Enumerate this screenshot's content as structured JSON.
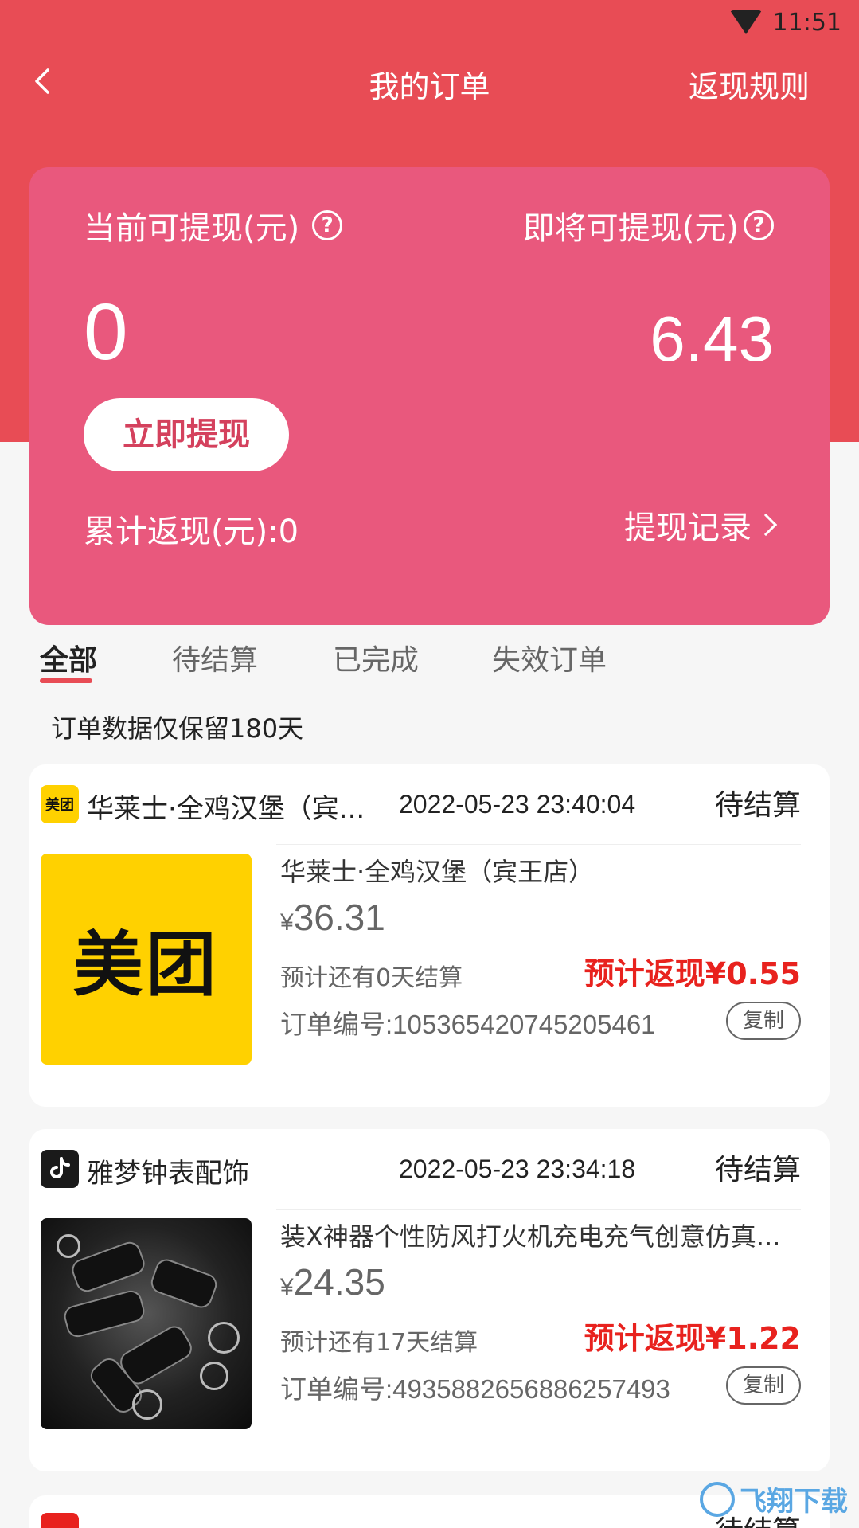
{
  "status_bar": {
    "time": "11:51",
    "wifi_icon": "wifi-icon"
  },
  "nav": {
    "title": "我的订单",
    "rule_link": "返现规则",
    "back_icon": "chevron-left-icon"
  },
  "balance_card": {
    "available_label": "当前可提现(元)",
    "available_amount": "0",
    "upcoming_label": "即将可提现(元)",
    "upcoming_amount": "6.43",
    "withdraw_button": "立即提现",
    "total_cashback": "累计返现(元):0",
    "record_link": "提现记录"
  },
  "tabs": [
    {
      "label": "全部",
      "active": true
    },
    {
      "label": "待结算",
      "active": false
    },
    {
      "label": "已完成",
      "active": false
    },
    {
      "label": "失效订单",
      "active": false
    }
  ],
  "notice": "订单数据仅保留180天",
  "orders": [
    {
      "shop_icon": "meituan-icon",
      "shop_icon_text": "美团",
      "shop_name": "华莱士·全鸡汉堡（宾...",
      "time": "2022-05-23 23:40:04",
      "status": "待结算",
      "thumb_text": "美团",
      "title": "华莱士·全鸡汉堡（宾王店）",
      "currency": "¥",
      "price": "36.31",
      "settle_text": "预计还有0天结算",
      "cashback": "预计返现¥0.55",
      "order_no": "订单编号:1053654207452054​61",
      "copy_label": "复制"
    },
    {
      "shop_icon": "tiktok-icon",
      "shop_name": "雅梦钟表配饰",
      "time": "2022-05-23 23:34:18",
      "status": "待结算",
      "title": "装X神器个性防风打火机充电充气创意仿真...",
      "currency": "¥",
      "price": "24.35",
      "settle_text": "预计还有17天结算",
      "cashback": "预计返现¥1.22",
      "order_no": "订单编号:4935882656886257493",
      "copy_label": "复制"
    }
  ],
  "peek": {
    "status": "待结算"
  },
  "watermark": "飞翔下载"
}
